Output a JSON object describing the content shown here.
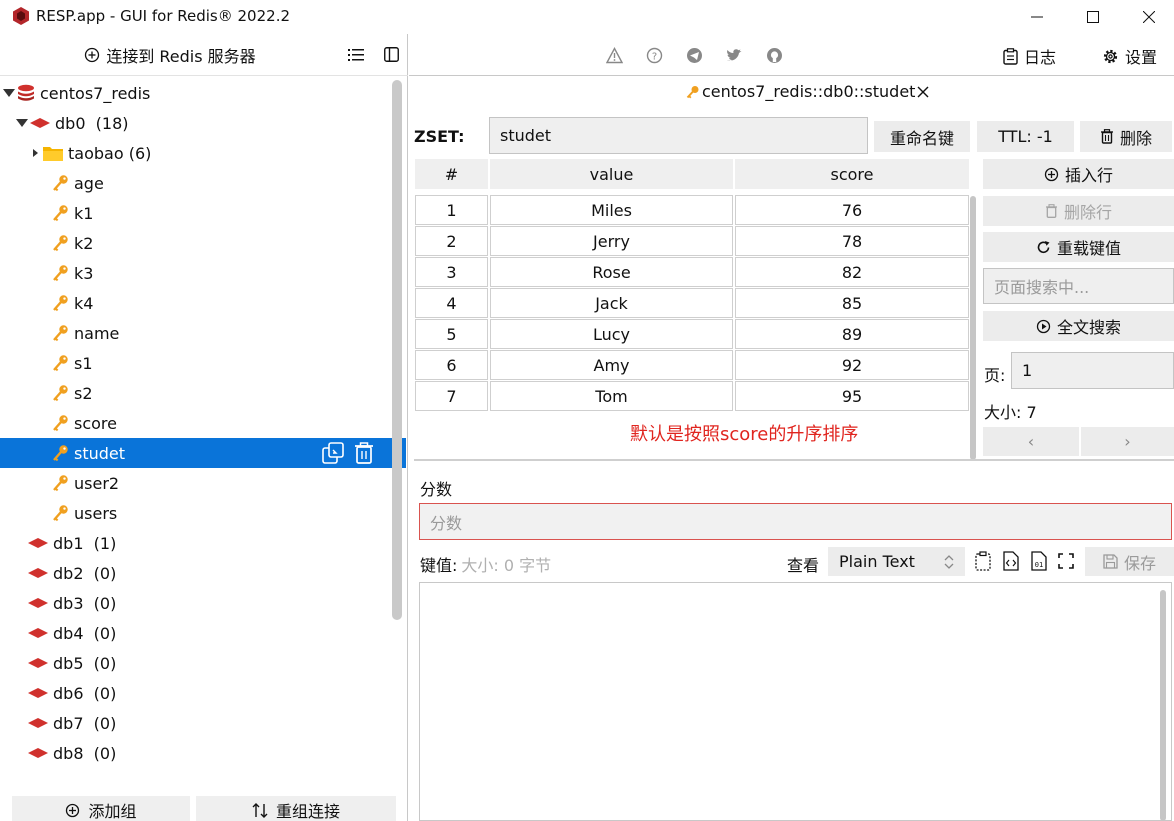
{
  "window": {
    "title": "RESP.app - GUI for Redis® 2022.2"
  },
  "left": {
    "connect_label": "连接到 Redis 服务器",
    "tree": [
      {
        "label": "centos7_redis",
        "kind": "server",
        "indent": 0
      },
      {
        "label": "db0  (18)",
        "kind": "db-open",
        "indent": 1
      },
      {
        "label": "taobao (6)",
        "kind": "folder",
        "indent": 2
      },
      {
        "label": "age",
        "kind": "key",
        "indent": 2
      },
      {
        "label": "k1",
        "kind": "key",
        "indent": 2
      },
      {
        "label": "k2",
        "kind": "key",
        "indent": 2
      },
      {
        "label": "k3",
        "kind": "key",
        "indent": 2
      },
      {
        "label": "k4",
        "kind": "key",
        "indent": 2
      },
      {
        "label": "name",
        "kind": "key",
        "indent": 2
      },
      {
        "label": "s1",
        "kind": "key",
        "indent": 2
      },
      {
        "label": "s2",
        "kind": "key",
        "indent": 2
      },
      {
        "label": "score",
        "kind": "key",
        "indent": 2
      },
      {
        "label": "studet",
        "kind": "key",
        "indent": 2,
        "selected": true
      },
      {
        "label": "user2",
        "kind": "key",
        "indent": 2
      },
      {
        "label": "users",
        "kind": "key",
        "indent": 2
      },
      {
        "label": "db1  (1)",
        "kind": "db",
        "indent": 1
      },
      {
        "label": "db2  (0)",
        "kind": "db",
        "indent": 1
      },
      {
        "label": "db3  (0)",
        "kind": "db",
        "indent": 1
      },
      {
        "label": "db4  (0)",
        "kind": "db",
        "indent": 1
      },
      {
        "label": "db5  (0)",
        "kind": "db",
        "indent": 1
      },
      {
        "label": "db6  (0)",
        "kind": "db",
        "indent": 1
      },
      {
        "label": "db7  (0)",
        "kind": "db",
        "indent": 1
      },
      {
        "label": "db8  (0)",
        "kind": "db",
        "indent": 1
      }
    ],
    "add_group": "添加组",
    "regroup": "重组连接"
  },
  "toolbar": {
    "log": "日志",
    "settings": "设置"
  },
  "tab": {
    "title": "centos7_redis::db0::studet"
  },
  "key": {
    "type_label": "ZSET:",
    "name": "studet",
    "rename": "重命名键",
    "ttl": "TTL:  -1",
    "delete": "删除"
  },
  "table": {
    "headers": [
      "#",
      "value",
      "score"
    ],
    "rows": [
      [
        "1",
        "Miles",
        "76"
      ],
      [
        "2",
        "Jerry",
        "78"
      ],
      [
        "3",
        "Rose",
        "82"
      ],
      [
        "4",
        "Jack",
        "85"
      ],
      [
        "5",
        "Lucy",
        "89"
      ],
      [
        "6",
        "Amy",
        "92"
      ],
      [
        "7",
        "Tom",
        "95"
      ]
    ],
    "annotation": "默认是按照score的升序排序"
  },
  "side": {
    "insert_row": "插入行",
    "delete_row": "删除行",
    "reload": "重载键值",
    "search_placeholder": "页面搜索中...",
    "fulltext": "全文搜索",
    "page_label": "页:",
    "page_value": "1",
    "size_label": "大小:  7"
  },
  "editor": {
    "score_label": "分数",
    "score_placeholder": "分数",
    "value_label": "键值:",
    "size_info": "大小:  0 字节",
    "view_label": "查看",
    "view_mode": "Plain Text",
    "save": "保存"
  },
  "colors": {
    "accent": "#0a74d9",
    "db_red": "#d0312d",
    "key_orange": "#f0a020",
    "annotation": "#e0251f"
  }
}
